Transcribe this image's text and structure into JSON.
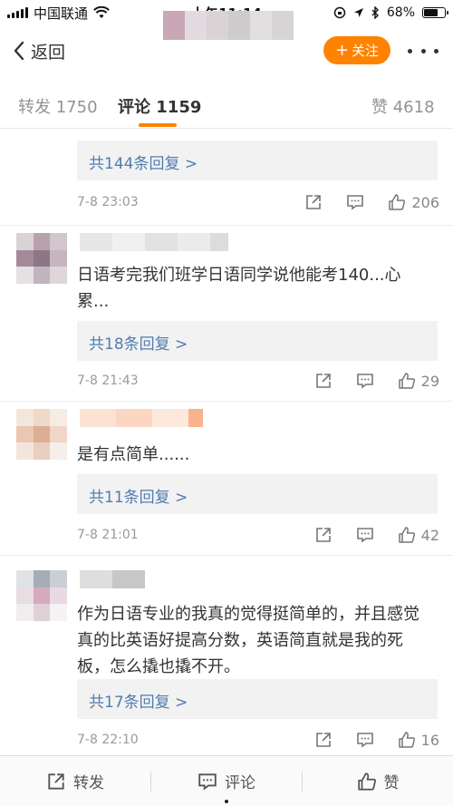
{
  "status_bar": {
    "carrier": "中国联通",
    "time": "上午11:14",
    "battery": "68%",
    "battery_level": 0.68
  },
  "nav": {
    "back_label": "返回",
    "follow_label": "关注",
    "follow_prefix": "+",
    "icons": [
      "back-chevron-icon",
      "more-dots-icon"
    ]
  },
  "tabs": {
    "repost": "转发 1750",
    "comment": "评论 1159",
    "like": "赞 4618"
  },
  "comments": [
    {
      "text": "",
      "reply_label": "共144条回复 >",
      "time": "7-8 23:03",
      "likes": "206"
    },
    {
      "text": "日语考完我们班学日语同学说他能考140...心累...",
      "reply_label": "共18条回复 >",
      "time": "7-8 21:43",
      "likes": "29"
    },
    {
      "text": "是有点简单......",
      "reply_label": "共11条回复 >",
      "time": "7-8 21:01",
      "likes": "42"
    },
    {
      "text": "作为日语专业的我真的觉得挺简单的，并且感觉真的比英语好提高分数，英语简直就是我的死板，怎么撬也撬不开。",
      "reply_label": "共17条回复 >",
      "time": "7-8 22:10",
      "likes": "16"
    }
  ],
  "toolbar": {
    "repost": "转发",
    "comment": "评论",
    "like": "赞"
  },
  "colors": {
    "accent": "#ff8200",
    "link": "#507daf",
    "muted": "#999999"
  }
}
